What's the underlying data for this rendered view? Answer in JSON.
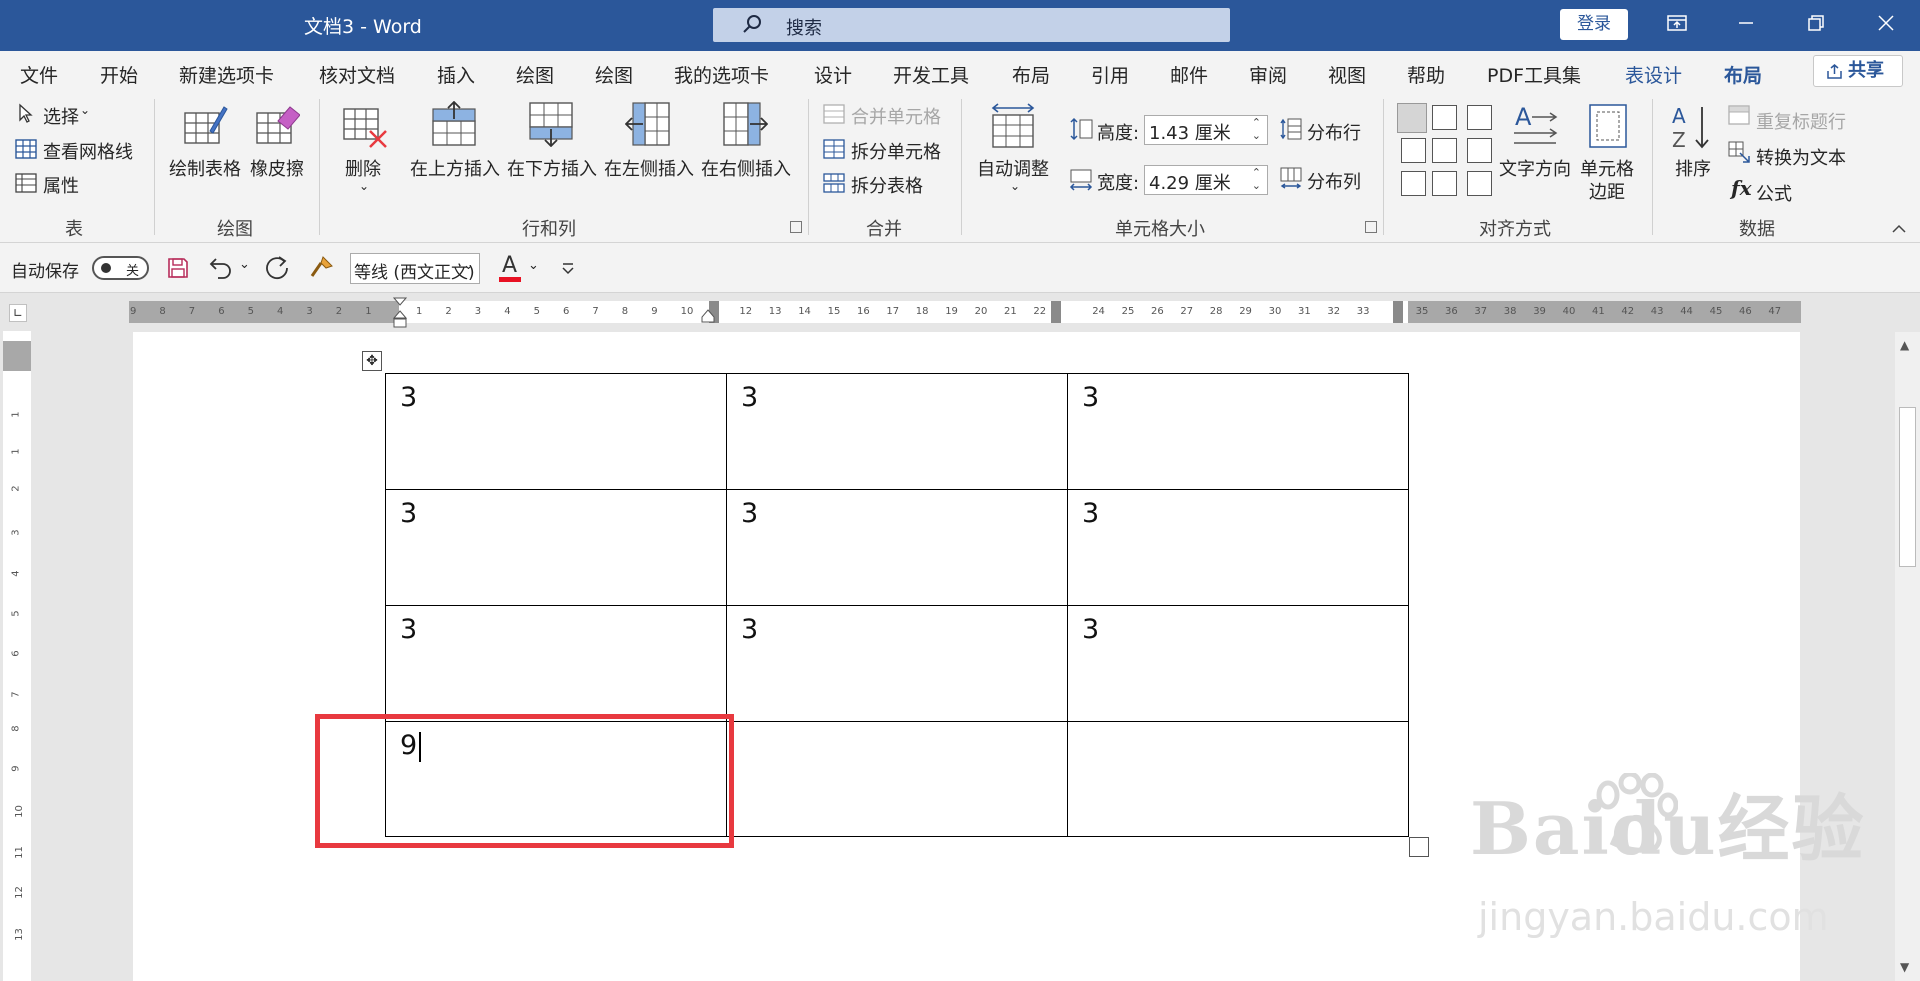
{
  "titlebar": {
    "doc_title": "文档3 - Word",
    "search_label": "搜索",
    "login_label": "登录"
  },
  "tabs": [
    "文件",
    "开始",
    "新建选项卡",
    "核对文档",
    "插入",
    "绘图",
    "绘图",
    "我的选项卡",
    "设计",
    "开发工具",
    "布局",
    "引用",
    "邮件",
    "审阅",
    "视图",
    "帮助",
    "PDF工具集",
    "表设计",
    "布局"
  ],
  "share_label": "共享",
  "ribbon": {
    "table": {
      "select": "选择",
      "gridlines": "查看网格线",
      "properties": "属性",
      "group": "表"
    },
    "draw": {
      "draw_table": "绘制表格",
      "eraser": "橡皮擦",
      "group": "绘图"
    },
    "rowscols": {
      "delete": "删除",
      "insert_above": "在上方插入",
      "insert_below": "在下方插入",
      "insert_left": "在左侧插入",
      "insert_right": "在右侧插入",
      "group": "行和列"
    },
    "merge": {
      "merge_cells": "合并单元格",
      "split_cells": "拆分单元格",
      "split_table": "拆分表格",
      "group": "合并"
    },
    "cellsize": {
      "autofit": "自动调整",
      "height_label": "高度:",
      "height_value": "1.43 厘米",
      "width_label": "宽度:",
      "width_value": "4.29 厘米",
      "dist_rows": "分布行",
      "dist_cols": "分布列",
      "group": "单元格大小"
    },
    "align": {
      "text_direction": "文字方向",
      "cell_margins_1": "单元格",
      "cell_margins_2": "边距",
      "group": "对齐方式"
    },
    "data": {
      "sort": "排序",
      "repeat_header": "重复标题行",
      "convert_text": "转换为文本",
      "formula": "公式",
      "group": "数据"
    }
  },
  "qat": {
    "autosave_label": "自动保存",
    "autosave_state": "关",
    "font_name": "等线 (西文正文)",
    "font_color_letter": "A"
  },
  "hruler_left": [
    "9",
    "8",
    "7",
    "6",
    "5",
    "4",
    "3",
    "2",
    "1"
  ],
  "hruler_right": [
    "1",
    "2",
    "3",
    "4",
    "5",
    "6",
    "7",
    "8",
    "9",
    "10",
    "",
    "12",
    "13",
    "14",
    "15",
    "16",
    "17",
    "18",
    "19",
    "20",
    "21",
    "22",
    "",
    "24",
    "25",
    "26",
    "27",
    "28",
    "29",
    "30",
    "31",
    "32",
    "33",
    "",
    "35",
    "36",
    "37",
    "38",
    "39",
    "40",
    "41",
    "42",
    "43",
    "44",
    "45",
    "46",
    "47"
  ],
  "vruler": [
    "1",
    "1",
    "2",
    "3",
    "4",
    "5",
    "6",
    "7",
    "8",
    "9",
    "10",
    "11",
    "12",
    "13"
  ],
  "table_rows": [
    [
      "3",
      "3",
      "3"
    ],
    [
      "3",
      "3",
      "3"
    ],
    [
      "3",
      "3",
      "3"
    ],
    [
      "9",
      "",
      ""
    ]
  ],
  "watermark": {
    "brand": "Baidu经验",
    "url": "jingyan.baidu.com"
  },
  "colors": {
    "accent": "#2b579a",
    "highlight": "#e8393f"
  }
}
